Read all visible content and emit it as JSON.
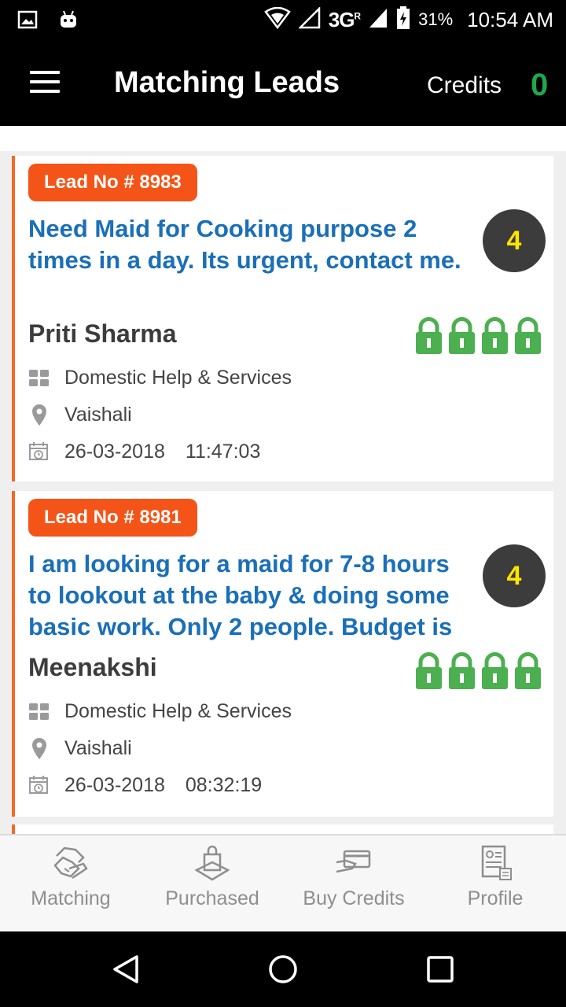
{
  "status_bar": {
    "network": "3G",
    "network_sup": "R",
    "battery": "31%",
    "time": "10:54 AM",
    "icons": [
      "image-icon",
      "android-icon",
      "wifi-icon",
      "signal-icon",
      "battery-charging-icon"
    ]
  },
  "app_bar": {
    "title": "Matching Leads",
    "credits_label": "Credits",
    "credits_value": "0"
  },
  "leads": [
    {
      "lead_no": "Lead No # 8983",
      "title": "Need Maid for Cooking purpose 2 times in a day. Its urgent, contact me.",
      "count": "4",
      "customer": "Priti Sharma",
      "locks": 4,
      "category": "Domestic Help & Services",
      "location": "Vaishali",
      "date": "26-03-2018",
      "time": "11:47:03"
    },
    {
      "lead_no": "Lead No # 8981",
      "title": "I am looking for a maid for 7-8 hours to lookout at the baby & doing some basic work. Only 2 people. Budget is",
      "count": "4",
      "customer": "Meenakshi",
      "locks": 4,
      "category": "Domestic Help & Services",
      "location": "Vaishali",
      "date": "26-03-2018",
      "time": "08:32:19"
    }
  ],
  "bottom_nav": [
    {
      "label": "Matching",
      "icon": "handshake-icon"
    },
    {
      "label": "Purchased",
      "icon": "shopping-bag-icon"
    },
    {
      "label": "Buy Credits",
      "icon": "credit-card-icon"
    },
    {
      "label": "Profile",
      "icon": "profile-document-icon"
    }
  ],
  "colors": {
    "accent_orange": "#f45417",
    "title_blue": "#1a6fb8",
    "lock_green": "#4caf50",
    "credits_green": "#1ea94a",
    "count_yellow": "#ffe500"
  }
}
